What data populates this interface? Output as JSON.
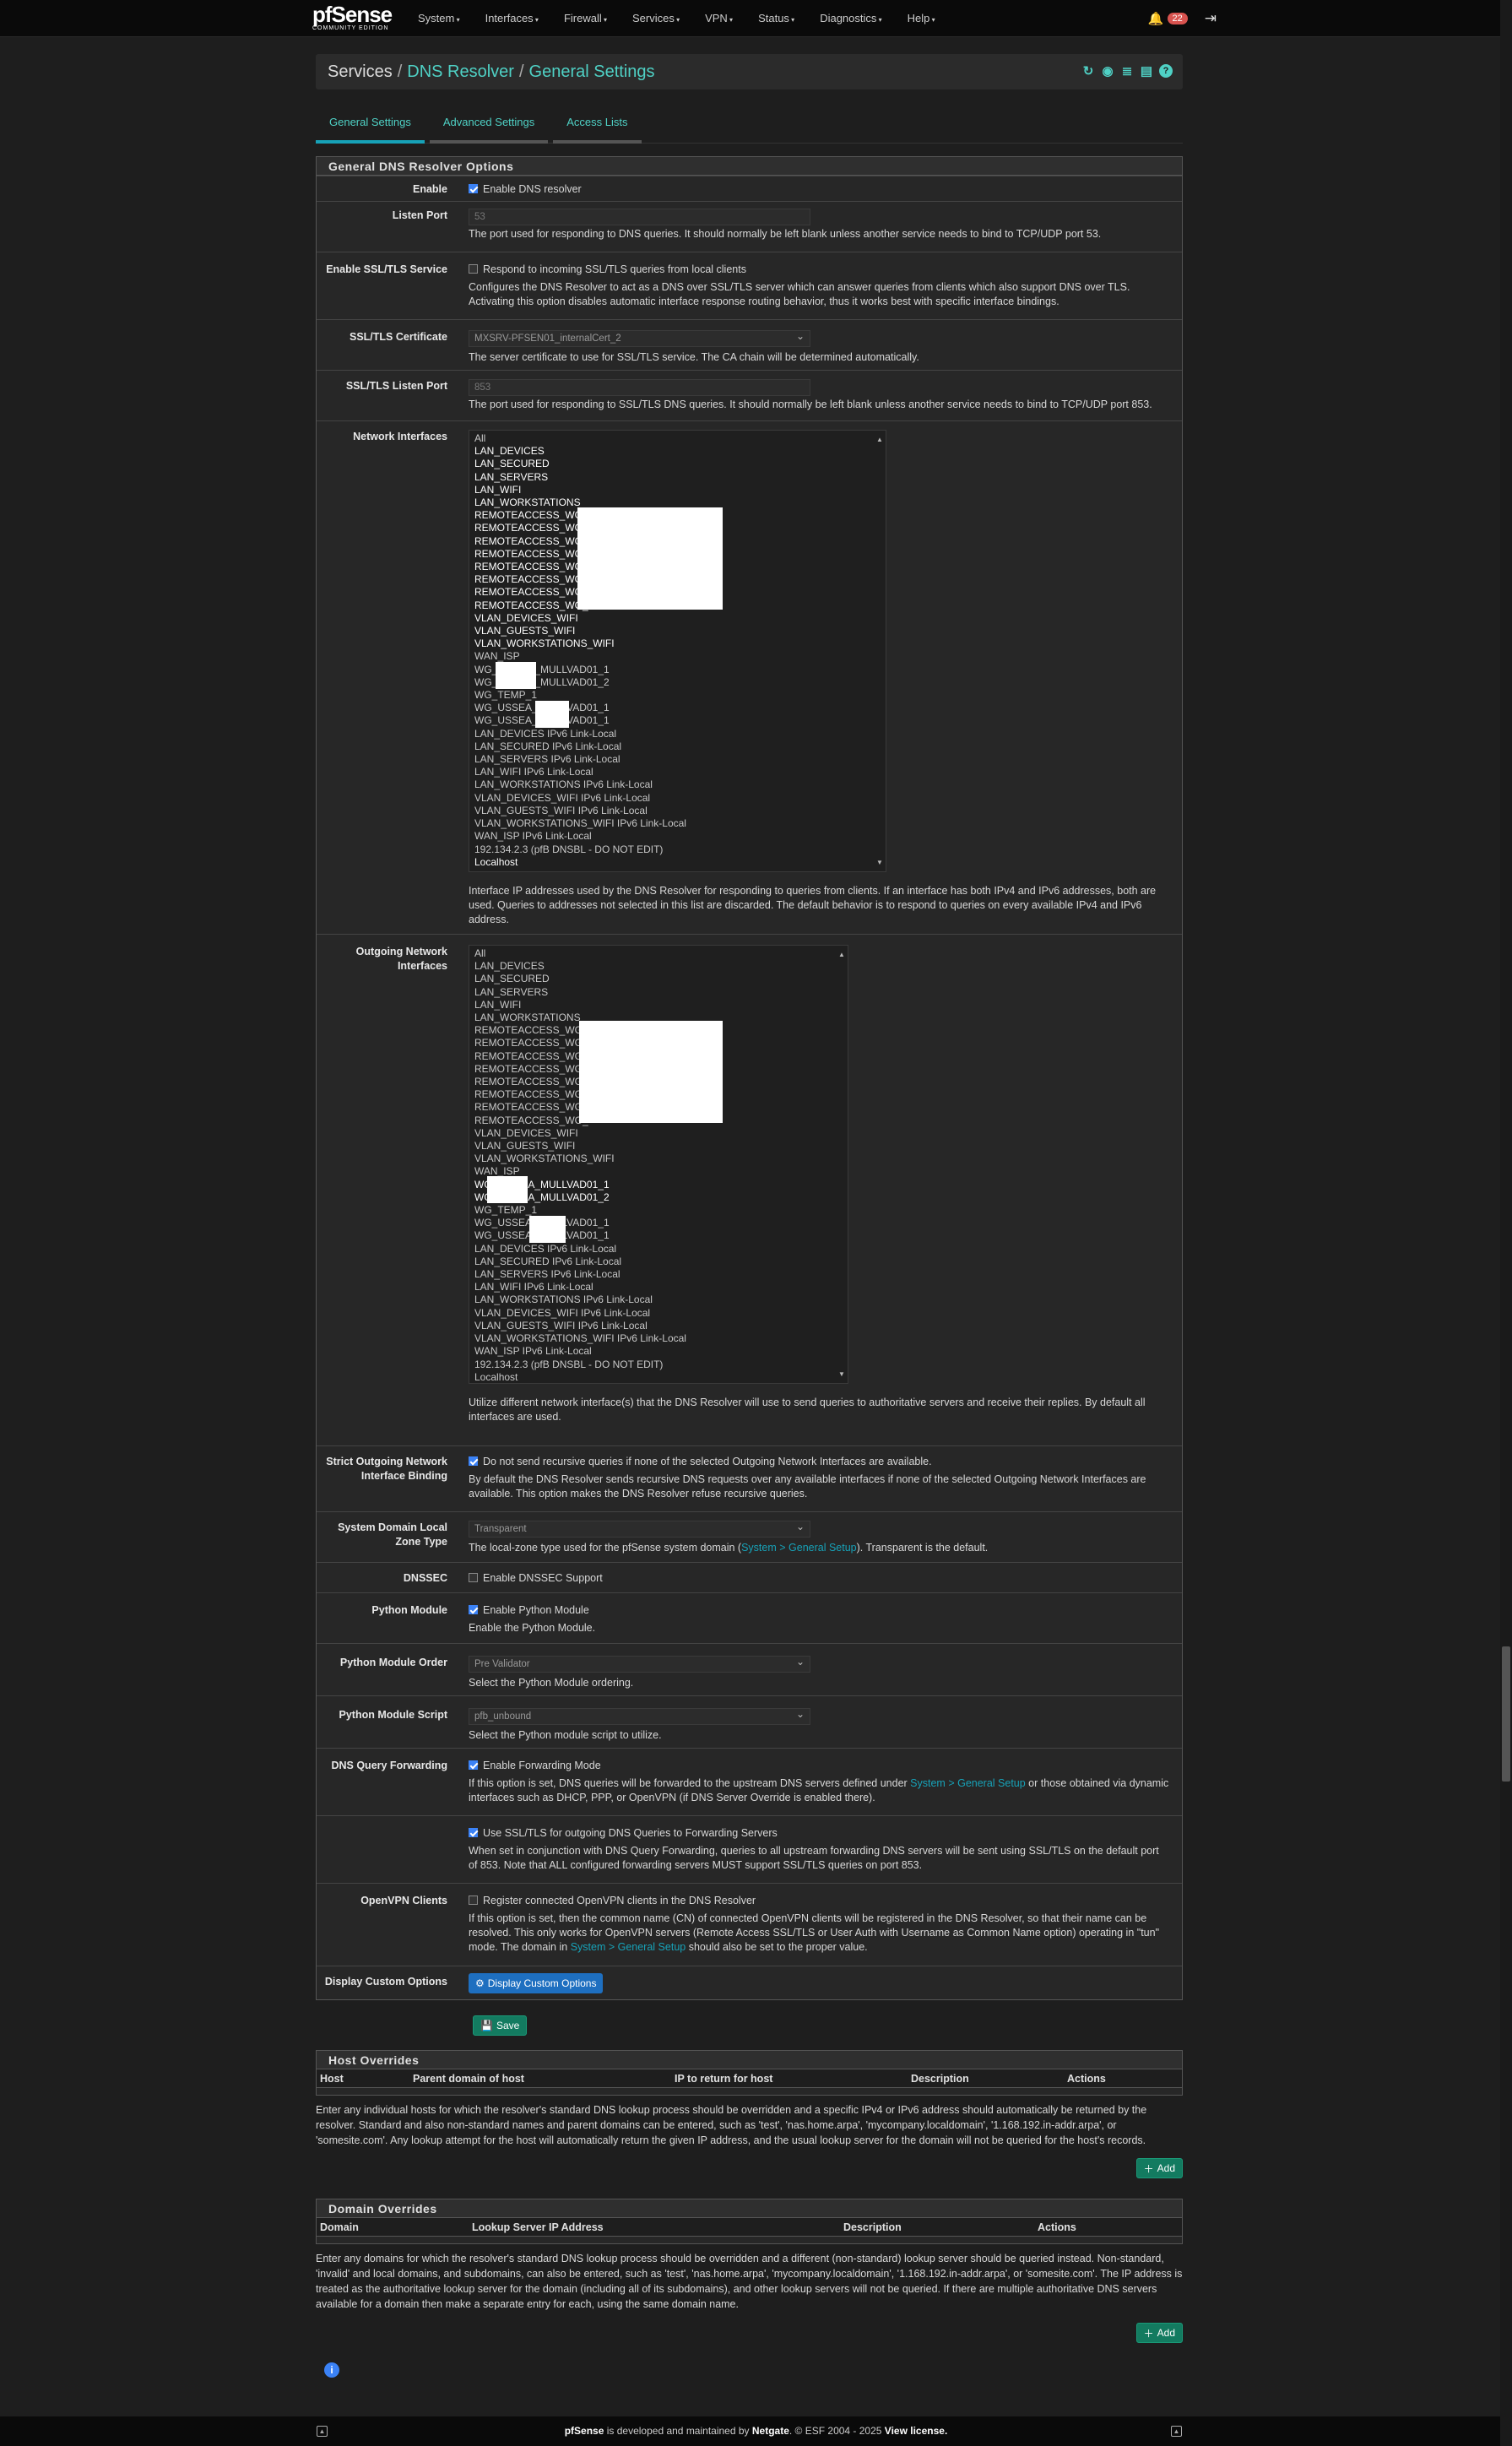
{
  "brand": {
    "name": "pfSense",
    "edition": "COMMUNITY EDITION"
  },
  "nav": [
    "System",
    "Interfaces",
    "Firewall",
    "Services",
    "VPN",
    "Status",
    "Diagnostics",
    "Help"
  ],
  "notifications": {
    "count": "22"
  },
  "breadcrumb": {
    "part1": "Services",
    "part2": "DNS Resolver",
    "part3": "General Settings",
    "sep": "/"
  },
  "tabs": [
    "General Settings",
    "Advanced Settings",
    "Access Lists"
  ],
  "panel_title": "General DNS Resolver Options",
  "enable": {
    "label": "Enable",
    "text": "Enable DNS resolver"
  },
  "listen_port": {
    "label": "Listen Port",
    "placeholder": "53",
    "help": "The port used for responding to DNS queries. It should normally be left blank unless another service needs to bind to TCP/UDP port 53."
  },
  "ssl_service": {
    "label": "Enable SSL/TLS Service",
    "text": "Respond to incoming SSL/TLS queries from local clients",
    "help": "Configures the DNS Resolver to act as a DNS over SSL/TLS server which can answer queries from clients which also support DNS over TLS. Activating this option disables automatic interface response routing behavior, thus it works best with specific interface bindings."
  },
  "ssl_cert": {
    "label": "SSL/TLS Certificate",
    "value": "MXSRV-PFSEN01_internalCert_2",
    "help": "The server certificate to use for SSL/TLS service. The CA chain will be determined automatically."
  },
  "ssl_port": {
    "label": "SSL/TLS Listen Port",
    "placeholder": "853",
    "help": "The port used for responding to SSL/TLS DNS queries. It should normally be left blank unless another service needs to bind to TCP/UDP port 853."
  },
  "net_if": {
    "label": "Network Interfaces",
    "help": "Interface IP addresses used by the DNS Resolver for responding to queries from clients. If an interface has both IPv4 and IPv6 addresses, both are used. Queries to addresses not selected in this list are discarded. The default behavior is to respond to queries on every available IPv4 and IPv6 address.",
    "options": [
      "All",
      "LAN_DEVICES",
      "LAN_SECURED",
      "LAN_SERVERS",
      "LAN_WIFI",
      "LAN_WORKSTATIONS",
      "REMOTEACCESS_WG_",
      "REMOTEACCESS_WG_",
      "REMOTEACCESS_WG_",
      "REMOTEACCESS_WG_",
      "REMOTEACCESS_WG_",
      "REMOTEACCESS_WG_",
      "REMOTEACCESS_WG_",
      "REMOTEACCESS_WG_",
      "VLAN_DEVICES_WIFI",
      "VLAN_GUESTS_WIFI",
      "VLAN_WORKSTATIONS_WIFI",
      "WAN_ISP",
      "WG_           USSEA_MULLVAD01_1",
      "WG_           USSEA_MULLVAD01_2",
      "WG_TEMP_1",
      "WG_USSEA_           MULLVAD01_1",
      "WG_USSEA_           MULLVAD01_1",
      "LAN_DEVICES IPv6 Link-Local",
      "LAN_SECURED IPv6 Link-Local",
      "LAN_SERVERS IPv6 Link-Local",
      "LAN_WIFI IPv6 Link-Local",
      "LAN_WORKSTATIONS IPv6 Link-Local",
      "VLAN_DEVICES_WIFI IPv6 Link-Local",
      "VLAN_GUESTS_WIFI IPv6 Link-Local",
      "VLAN_WORKSTATIONS_WIFI IPv6 Link-Local",
      "WAN_ISP IPv6 Link-Local",
      "192.134.2.3 (pfB DNSBL - DO NOT EDIT)",
      "Localhost"
    ]
  },
  "out_if": {
    "label": "Outgoing Network Interfaces",
    "help": "Utilize different network interface(s) that the DNS Resolver will use to send queries to authoritative servers and receive their replies. By default all interfaces are used.",
    "options": [
      "All",
      "LAN_DEVICES",
      "LAN_SECURED",
      "LAN_SERVERS",
      "LAN_WIFI",
      "LAN_WORKSTATIONS",
      "REMOTEACCESS_WG_",
      "REMOTEACCESS_WG_",
      "REMOTEACCESS_WG_",
      "REMOTEACCESS_WG_",
      "REMOTEACCESS_WG_",
      "REMOTEACCESS_WG_",
      "REMOTEACCESS_WG_",
      "REMOTEACCESS_WG_",
      "VLAN_DEVICES_WIFI",
      "VLAN_GUESTS_WIFI",
      "VLAN_WORKSTATIONS_WIFI",
      "WAN_ISP",
      "WG_           USSEA_MULLVAD01_1",
      "WG_           USSEA_MULLVAD01_2",
      "WG_TEMP_1",
      "WG_USSEA_           MULLVAD01_1",
      "WG_USSEA_           MULLVAD01_1",
      "LAN_DEVICES IPv6 Link-Local",
      "LAN_SECURED IPv6 Link-Local",
      "LAN_SERVERS IPv6 Link-Local",
      "LAN_WIFI IPv6 Link-Local",
      "LAN_WORKSTATIONS IPv6 Link-Local",
      "VLAN_DEVICES_WIFI IPv6 Link-Local",
      "VLAN_GUESTS_WIFI IPv6 Link-Local",
      "VLAN_WORKSTATIONS_WIFI IPv6 Link-Local",
      "WAN_ISP IPv6 Link-Local",
      "192.134.2.3 (pfB DNSBL - DO NOT EDIT)",
      "Localhost"
    ]
  },
  "strict": {
    "label": "Strict Outgoing Network Interface Binding",
    "text": "Do not send recursive queries if none of the selected Outgoing Network Interfaces are available.",
    "help": "By default the DNS Resolver sends recursive DNS requests over any available interfaces if none of the selected Outgoing Network Interfaces are available. This option makes the DNS Resolver refuse recursive queries."
  },
  "zone": {
    "label": "System Domain Local Zone Type",
    "value": "Transparent",
    "help_pre": "The local-zone type used for the pfSense system domain (",
    "help_link": "System > General Setup",
    "help_post": "). Transparent is the default."
  },
  "dnssec": {
    "label": "DNSSEC",
    "text": "Enable DNSSEC Support"
  },
  "python": {
    "label": "Python Module",
    "text": "Enable Python Module",
    "help": "Enable the Python Module."
  },
  "py_order": {
    "label": "Python Module Order",
    "value": "Pre Validator",
    "help": "Select the Python Module ordering."
  },
  "py_script": {
    "label": "Python Module Script",
    "value": "pfb_unbound",
    "help": "Select the Python module script to utilize."
  },
  "fwd": {
    "label": "DNS Query Forwarding",
    "text": "Enable Forwarding Mode",
    "help_pre": "If this option is set, DNS queries will be forwarded to the upstream DNS servers defined under ",
    "help_link": "System > General Setup",
    "help_post": " or those obtained via dynamic interfaces such as DHCP, PPP, or OpenVPN (if DNS Server Override is enabled there)."
  },
  "fwd_ssl": {
    "text": "Use SSL/TLS for outgoing DNS Queries to Forwarding Servers",
    "help": "When set in conjunction with DNS Query Forwarding, queries to all upstream forwarding DNS servers will be sent using SSL/TLS on the default port of 853. Note that ALL configured forwarding servers MUST support SSL/TLS queries on port 853."
  },
  "ovpn": {
    "label": "OpenVPN Clients",
    "text": "Register connected OpenVPN clients in the DNS Resolver",
    "help_pre": "If this option is set, then the common name (CN) of connected OpenVPN clients will be registered in the DNS Resolver, so that their name can be resolved. This only works for OpenVPN servers (Remote Access SSL/TLS or User Auth with Username as Common Name option) operating in \"tun\" mode. The domain in ",
    "help_link": "System > General Setup",
    "help_post": " should also be set to the proper value."
  },
  "custom": {
    "label": "Display Custom Options",
    "button": "Display Custom Options"
  },
  "save": "Save",
  "host_overrides": {
    "title": "Host Overrides",
    "cols": [
      "Host",
      "Parent domain of host",
      "IP to return for host",
      "Description",
      "Actions"
    ],
    "help": "Enter any individual hosts for which the resolver's standard DNS lookup process should be overridden and a specific IPv4 or IPv6 address should automatically be returned by the resolver. Standard and also non-standard names and parent domains can be entered, such as 'test', 'nas.home.arpa', 'mycompany.localdomain', '1.168.192.in-addr.arpa', or 'somesite.com'. Any lookup attempt for the host will automatically return the given IP address, and the usual lookup server for the domain will not be queried for the host's records.",
    "add": "Add"
  },
  "domain_overrides": {
    "title": "Domain Overrides",
    "cols": [
      "Domain",
      "Lookup Server IP Address",
      "Description",
      "Actions"
    ],
    "help": "Enter any domains for which the resolver's standard DNS lookup process should be overridden and a different (non-standard) lookup server should be queried instead. Non-standard, 'invalid' and local domains, and subdomains, can also be entered, such as 'test', 'nas.home.arpa', 'mycompany.localdomain', '1.168.192.in-addr.arpa', or 'somesite.com'. The IP address is treated as the authoritative lookup server for the domain (including all of its subdomains), and other lookup servers will not be queried. If there are multiple authoritative DNS servers available for a domain then make a separate entry for each, using the same domain name.",
    "add": "Add"
  },
  "footer": {
    "brand": "pfSense",
    "mid": " is developed and maintained by ",
    "netgate": "Netgate",
    "copy": ". © ESF 2004 - 2025 ",
    "license": "View license."
  }
}
